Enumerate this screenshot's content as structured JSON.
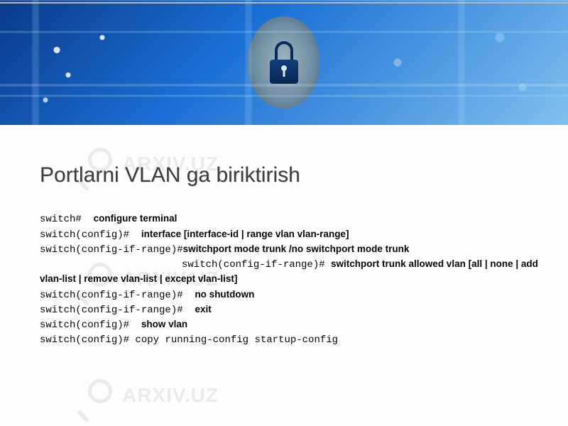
{
  "watermark_text": "ARXIV.UZ",
  "slide": {
    "title": "Portlarni VLAN ga biriktirish"
  },
  "commands": {
    "line1": {
      "prompt": "switch#  ",
      "cmd": "configure terminal"
    },
    "line2": {
      "prompt": "switch(config)#  ",
      "cmd": "interface [interface-id | range vlan vlan-range]"
    },
    "line3": {
      "prompt": "switch(config-if-range)#",
      "cmd": "switchport mode trunk /no switchport mode trunk"
    },
    "line4": {
      "prompt": "switch(config-if-range)#  ",
      "cmd": "switchport trunk allowed vlan [all | none | add vlan-list |                   remove vlan-list | except vlan-list]"
    },
    "line6": {
      "prompt": "switch(config-if-range)#  ",
      "cmd": "no shutdown"
    },
    "line7": {
      "prompt": "switch(config-if-range)#  ",
      "cmd": "exit"
    },
    "line8": {
      "prompt": "switch(config)#  ",
      "cmd": "show vlan"
    },
    "line9_full": "switch(config)# copy running-config startup-config"
  }
}
